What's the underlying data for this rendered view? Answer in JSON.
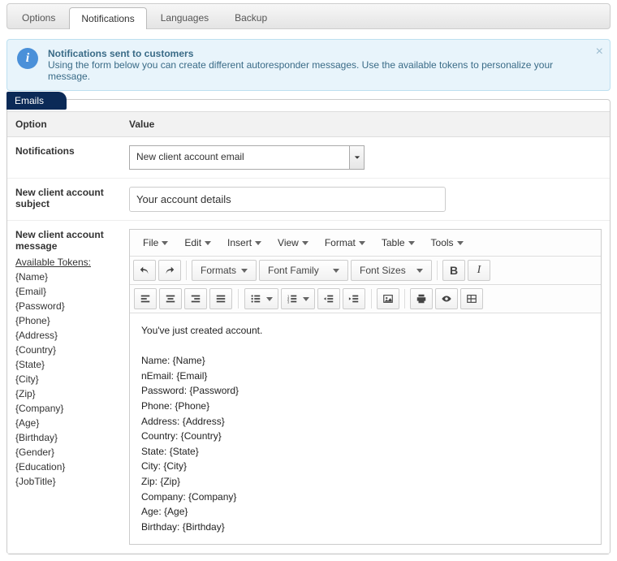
{
  "tabs": [
    "Options",
    "Notifications",
    "Languages",
    "Backup"
  ],
  "active_tab": 1,
  "info": {
    "title": "Notifications sent to customers",
    "body": "Using the form below you can create different autoresponder messages. Use the available tokens to personalize your message."
  },
  "panel_title": "Emails",
  "columns": {
    "option": "Option",
    "value": "Value"
  },
  "rows": {
    "notifications": {
      "label": "Notifications",
      "selected": "New client account email"
    },
    "subject": {
      "label": "New client account subject",
      "value": "Your account details"
    },
    "message": {
      "label": "New client account message",
      "tokens_heading": "Available Tokens:",
      "tokens": [
        "{Name}",
        "{Email}",
        "{Password}",
        "{Phone}",
        "{Address}",
        "{Country}",
        "{State}",
        "{City}",
        "{Zip}",
        "{Company}",
        "{Age}",
        "{Birthday}",
        "{Gender}",
        "{Education}",
        "{JobTitle}"
      ]
    }
  },
  "editor": {
    "menus": [
      "File",
      "Edit",
      "Insert",
      "View",
      "Format",
      "Table",
      "Tools"
    ],
    "toolbar": {
      "formats": "Formats",
      "font_family": "Font Family",
      "font_sizes": "Font Sizes"
    },
    "content": "You've just created account.\n\nName: {Name}\nnEmail: {Email}\nPassword: {Password}\nPhone: {Phone}\nAddress: {Address}\nCountry: {Country}\nState: {State}\nCity: {City}\nZip: {Zip}\nCompany: {Company}\nAge: {Age}\nBirthday: {Birthday}"
  }
}
